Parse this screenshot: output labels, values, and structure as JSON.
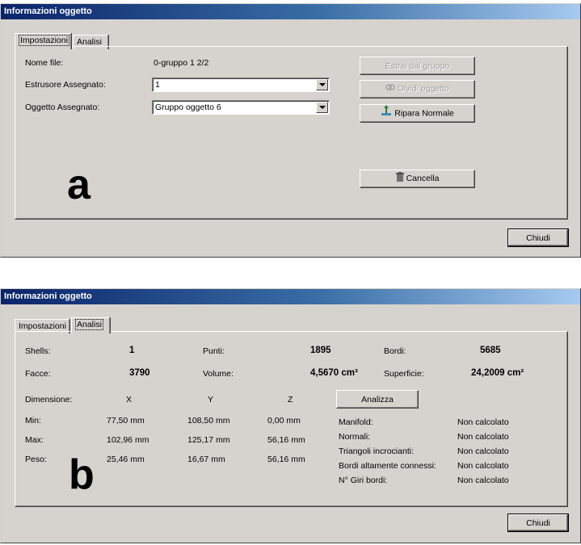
{
  "window_a": {
    "title": "Informazioni oggetto",
    "tabs": [
      "Impostazioni",
      "Analisi"
    ],
    "nome_file_label": "Nome file:",
    "nome_file_value": "0-gruppo 1 2/2",
    "estrusore_label": "Estrusore Assegnato:",
    "estrusore_value": "1",
    "oggetto_label": "Oggetto Assegnato:",
    "oggetto_value": "Gruppo oggetto 6",
    "btn_estrai": "Estrai dal gruppo",
    "btn_dividi": "Dividi oggetto",
    "btn_ripara": "Ripara Normale",
    "btn_cancella": "Cancella",
    "btn_chiudi": "Chiudi",
    "panel_letter": "a"
  },
  "window_b": {
    "title": "Informazioni oggetto",
    "tabs": [
      "Impostazioni",
      "Analisi"
    ],
    "shells_label": "Shells:",
    "shells_value": "1",
    "punti_label": "Punti:",
    "punti_value": "1895",
    "bordi_label": "Bordi:",
    "bordi_value": "5685",
    "facce_label": "Facce:",
    "facce_value": "3790",
    "volume_label": "Volume:",
    "volume_value": "4,5670 cm³",
    "superficie_label": "Superficie:",
    "superficie_value": "24,2009 cm²",
    "dimensione_label": "Dimensione:",
    "axes": [
      "X",
      "Y",
      "Z"
    ],
    "rows": [
      {
        "label": "Min:",
        "x": "77,50 mm",
        "y": "108,50 mm",
        "z": "0,00 mm"
      },
      {
        "label": "Max:",
        "x": "102,96 mm",
        "y": "125,17 mm",
        "z": "56,16 mm"
      },
      {
        "label": "Peso:",
        "x": "25,46 mm",
        "y": "16,67 mm",
        "z": "56,16 mm"
      }
    ],
    "btn_analizza": "Analizza",
    "checks": [
      {
        "label": "Manifold:",
        "value": "Non calcolato"
      },
      {
        "label": "Normali:",
        "value": "Non calcolato"
      },
      {
        "label": "Triangoli incrocianti:",
        "value": "Non calcolato"
      },
      {
        "label": "Bordi altamente connessi:",
        "value": "Non calcolato"
      },
      {
        "label": "N° Giri bordi:",
        "value": "Non calcolato"
      }
    ],
    "btn_chiudi": "Chiudi",
    "panel_letter": "b"
  }
}
